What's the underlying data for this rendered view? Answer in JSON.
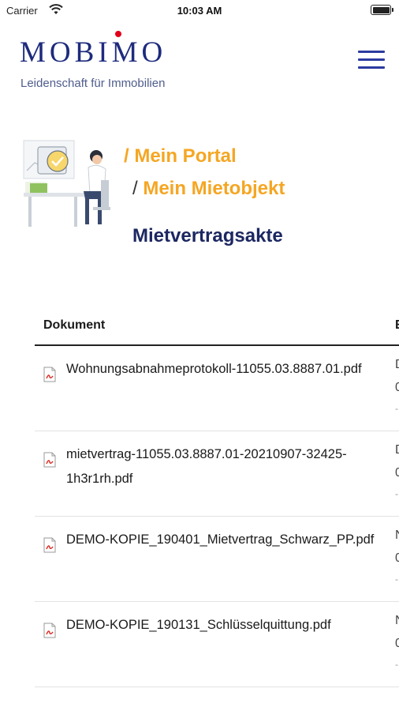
{
  "status": {
    "carrier": "Carrier",
    "time": "10:03 AM"
  },
  "header": {
    "logo": "MOBIMO",
    "tagline": "Leidenschaft für Immobilien",
    "menu_icon": "hamburger-menu-icon"
  },
  "breadcrumb": {
    "separator": "/",
    "items": [
      {
        "label": "Mein Portal"
      },
      {
        "label": "Mein Mietobjekt"
      }
    ]
  },
  "page": {
    "title": "Mietvertragsakte"
  },
  "table": {
    "columns": [
      "Dokument",
      "E"
    ],
    "rows": [
      {
        "name": "Wohnungsabnahmeprotokoll-11055.03.8887.01.pdf",
        "c1": "D",
        "c2": "0",
        "c3": "-"
      },
      {
        "name": "mietvertrag-11055.03.8887.01-20210907-32425-1h3r1rh.pdf",
        "c1": "D",
        "c2": "0",
        "c3": "-"
      },
      {
        "name": "DEMO-KOPIE_190401_Mietvertrag_Schwarz_PP.pdf",
        "c1": "N",
        "c2": "0",
        "c3": "-"
      },
      {
        "name": "DEMO-KOPIE_190131_Schlüsselquittung.pdf",
        "c1": "N",
        "c2": "0",
        "c3": "-"
      }
    ]
  },
  "colors": {
    "brand_blue": "#1e2b7d",
    "accent_orange": "#f5a623",
    "logo_dot_red": "#e2001a"
  }
}
